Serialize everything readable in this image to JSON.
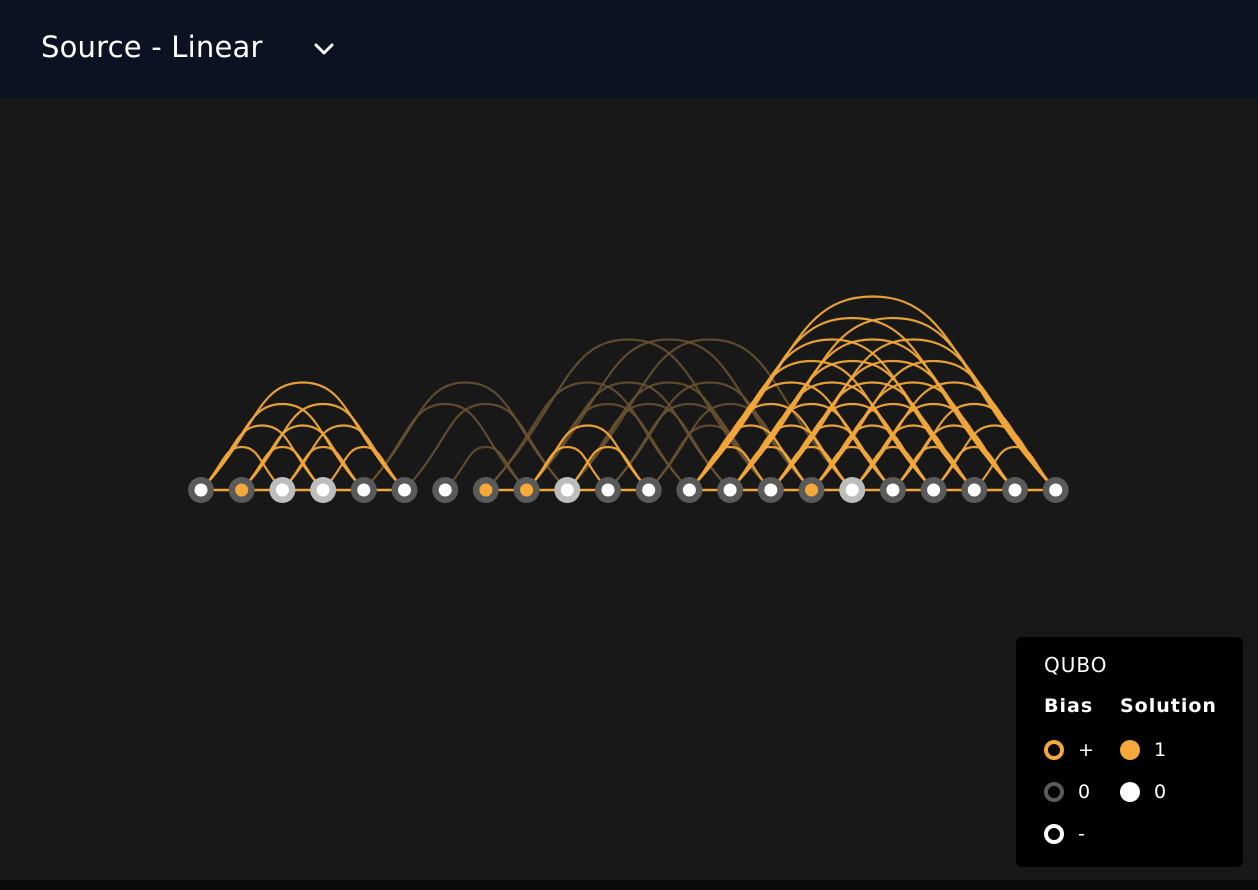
{
  "header": {
    "title": "Source - Linear",
    "dropdown_icon": "chevron-down-icon"
  },
  "colors": {
    "header_bg": "#0b1222",
    "canvas_bg": "#181818",
    "positive_bias": "#f5a93a",
    "zero_bias": "#5a5a5a",
    "negative_bias": "#ffffff",
    "solution_one": "#f5a93a",
    "solution_zero": "#ffffff",
    "active_edge": "#f0a63a",
    "inactive_edge": "#6b5433"
  },
  "legend": {
    "title": "QUBO",
    "bias_header": "Bias",
    "solution_header": "Solution",
    "bias_items": [
      {
        "label": "+",
        "color": "#f5a93a"
      },
      {
        "label": "0",
        "color": "#5a5a5a"
      },
      {
        "label": "-",
        "color": "#ffffff"
      }
    ],
    "solution_items": [
      {
        "label": "1",
        "color": "#f5a93a"
      },
      {
        "label": "0",
        "color": "#ffffff"
      }
    ]
  },
  "graph": {
    "node_count": 22,
    "nodes": [
      {
        "bias": "0",
        "solution": 0
      },
      {
        "bias": "0",
        "solution": 1
      },
      {
        "bias": "-",
        "solution": 0
      },
      {
        "bias": "-",
        "solution": 0
      },
      {
        "bias": "0",
        "solution": 0
      },
      {
        "bias": "0",
        "solution": 0
      },
      {
        "bias": "0",
        "solution": 0
      },
      {
        "bias": "0",
        "solution": 1
      },
      {
        "bias": "0",
        "solution": 1
      },
      {
        "bias": "-",
        "solution": 0
      },
      {
        "bias": "0",
        "solution": 0
      },
      {
        "bias": "0",
        "solution": 0
      },
      {
        "bias": "0",
        "solution": 0
      },
      {
        "bias": "0",
        "solution": 0
      },
      {
        "bias": "0",
        "solution": 0
      },
      {
        "bias": "0",
        "solution": 1
      },
      {
        "bias": "-",
        "solution": 0
      },
      {
        "bias": "0",
        "solution": 0
      },
      {
        "bias": "0",
        "solution": 0
      },
      {
        "bias": "0",
        "solution": 0
      },
      {
        "bias": "0",
        "solution": 0
      },
      {
        "bias": "0",
        "solution": 0
      }
    ],
    "chain_edges": [
      [
        0,
        1
      ],
      [
        1,
        2
      ],
      [
        2,
        3
      ],
      [
        3,
        4
      ],
      [
        4,
        5
      ],
      [
        7,
        8
      ],
      [
        8,
        9
      ],
      [
        9,
        10
      ],
      [
        10,
        11
      ],
      [
        12,
        13
      ],
      [
        13,
        14
      ],
      [
        14,
        15
      ],
      [
        15,
        16
      ],
      [
        16,
        17
      ],
      [
        17,
        18
      ],
      [
        18,
        19
      ],
      [
        19,
        20
      ],
      [
        20,
        21
      ]
    ],
    "active_arcs": [
      [
        0,
        2
      ],
      [
        0,
        3
      ],
      [
        0,
        4
      ],
      [
        0,
        5
      ],
      [
        1,
        3
      ],
      [
        1,
        4
      ],
      [
        1,
        5
      ],
      [
        2,
        4
      ],
      [
        2,
        5
      ],
      [
        3,
        5
      ],
      [
        8,
        10
      ],
      [
        8,
        11
      ],
      [
        9,
        11
      ],
      [
        12,
        14
      ],
      [
        12,
        15
      ],
      [
        12,
        16
      ],
      [
        12,
        17
      ],
      [
        12,
        18
      ],
      [
        12,
        19
      ],
      [
        12,
        20
      ],
      [
        12,
        21
      ],
      [
        13,
        15
      ],
      [
        13,
        16
      ],
      [
        13,
        17
      ],
      [
        13,
        18
      ],
      [
        13,
        19
      ],
      [
        13,
        20
      ],
      [
        13,
        21
      ],
      [
        14,
        16
      ],
      [
        14,
        17
      ],
      [
        14,
        18
      ],
      [
        14,
        19
      ],
      [
        14,
        20
      ],
      [
        14,
        21
      ],
      [
        15,
        17
      ],
      [
        15,
        18
      ],
      [
        15,
        19
      ],
      [
        15,
        20
      ],
      [
        15,
        21
      ],
      [
        16,
        18
      ],
      [
        16,
        19
      ],
      [
        16,
        20
      ],
      [
        16,
        21
      ],
      [
        17,
        19
      ],
      [
        17,
        20
      ],
      [
        17,
        21
      ],
      [
        18,
        20
      ],
      [
        18,
        21
      ],
      [
        19,
        21
      ]
    ],
    "inactive_arcs": [
      [
        4,
        8
      ],
      [
        4,
        9
      ],
      [
        5,
        9
      ],
      [
        6,
        8
      ],
      [
        7,
        12
      ],
      [
        8,
        12
      ],
      [
        8,
        13
      ],
      [
        9,
        13
      ],
      [
        9,
        14
      ],
      [
        10,
        14
      ],
      [
        11,
        15
      ],
      [
        7,
        14
      ],
      [
        8,
        15
      ],
      [
        9,
        16
      ],
      [
        10,
        15
      ],
      [
        11,
        14
      ]
    ]
  }
}
